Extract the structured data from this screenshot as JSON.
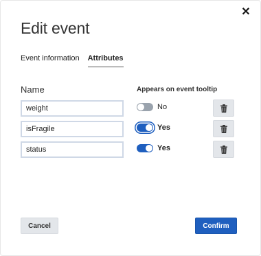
{
  "dialog": {
    "title": "Edit event",
    "close_icon": "close-icon",
    "close_glyph": "✕"
  },
  "tabs": [
    {
      "label": "Event information",
      "active": false
    },
    {
      "label": "Attributes",
      "active": true
    }
  ],
  "columns": {
    "name": "Name",
    "tooltip": "Appears on event tooltip"
  },
  "attributes": [
    {
      "name": "weight",
      "tooltip_on": false,
      "tooltip_label": "No",
      "delete_icon": "trash-icon"
    },
    {
      "name": "isFragile",
      "tooltip_on": true,
      "tooltip_label": "Yes",
      "delete_icon": "trash-icon",
      "focused": true
    },
    {
      "name": "status",
      "tooltip_on": true,
      "tooltip_label": "Yes",
      "delete_icon": "trash-icon"
    }
  ],
  "footer": {
    "cancel_label": "Cancel",
    "confirm_label": "Confirm"
  },
  "colors": {
    "primary": "#1f5fbf",
    "toggle_off": "#9aa3ad",
    "secondary_button": "#e3e6ea",
    "input_border": "#cfd8e6"
  }
}
